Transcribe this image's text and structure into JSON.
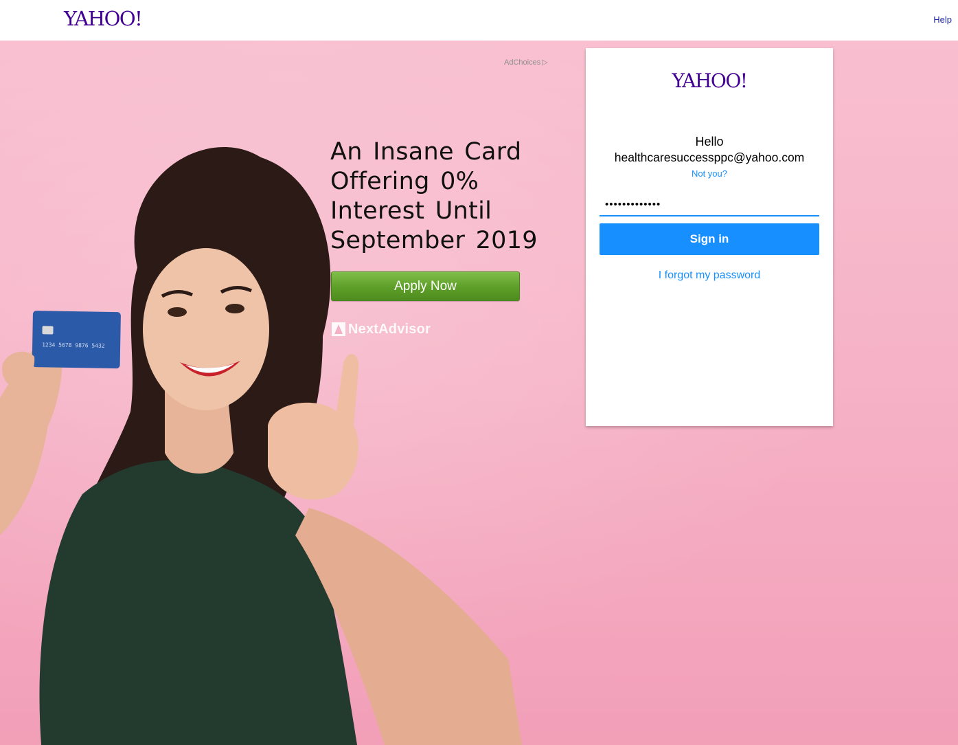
{
  "header": {
    "logo_text": "YAHOO!",
    "help_label": "Help"
  },
  "ad": {
    "adchoices_label": "AdChoices",
    "headline": "An Insane Card Offering 0% Interest Until September 2019",
    "cta_label": "Apply Now",
    "sponsor_name": "NextAdvisor",
    "card_number": "1234 5678 9876 5432"
  },
  "login": {
    "logo_text": "YAHOO!",
    "greeting": "Hello",
    "email": "healthcaresuccessppc@yahoo.com",
    "not_you_label": "Not you?",
    "password_value": "•••••••••••••",
    "signin_label": "Sign in",
    "forgot_label": "I forgot my password"
  },
  "colors": {
    "brand_purple": "#410093",
    "primary_blue": "#188fff",
    "cta_green": "#5d9e28",
    "hero_pink": "#f6b3c7"
  }
}
